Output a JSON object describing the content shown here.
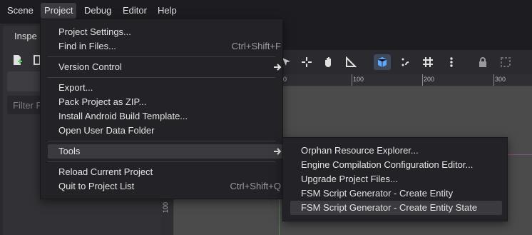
{
  "menubar": {
    "items": [
      "Scene",
      "Project",
      "Debug",
      "Editor",
      "Help"
    ],
    "active": "Project"
  },
  "dock": {
    "tab_label": "Inspe",
    "filter_placeholder": "Filter P"
  },
  "rulers": {
    "h_labels": [
      "0",
      "100",
      "200",
      "300"
    ],
    "v_label": "100"
  },
  "project_menu": {
    "items": [
      {
        "label": "Project Settings...",
        "shortcut": ""
      },
      {
        "label": "Find in Files...",
        "shortcut": "Ctrl+Shift+F"
      },
      {
        "label": "Version Control",
        "shortcut": ""
      },
      {
        "label": "Export...",
        "shortcut": ""
      },
      {
        "label": "Pack Project as ZIP...",
        "shortcut": ""
      },
      {
        "label": "Install Android Build Template...",
        "shortcut": ""
      },
      {
        "label": "Open User Data Folder",
        "shortcut": ""
      },
      {
        "label": "Tools",
        "shortcut": ""
      },
      {
        "label": "Reload Current Project",
        "shortcut": ""
      },
      {
        "label": "Quit to Project List",
        "shortcut": "Ctrl+Shift+Q"
      }
    ],
    "highlighted": "Tools"
  },
  "tools_submenu": {
    "items": [
      "Orphan Resource Explorer...",
      "Engine Compilation Configuration Editor...",
      "Upgrade Project Files...",
      "FSM Script Generator - Create Entity",
      "FSM Script Generator - Create Entity State"
    ],
    "highlighted": "FSM Script Generator - Create Entity State"
  },
  "colors": {
    "accent": "#5fa8ff",
    "menu_bg": "#232327",
    "highlight": "#3a3a3f",
    "canvas": "#4b4b4b"
  }
}
